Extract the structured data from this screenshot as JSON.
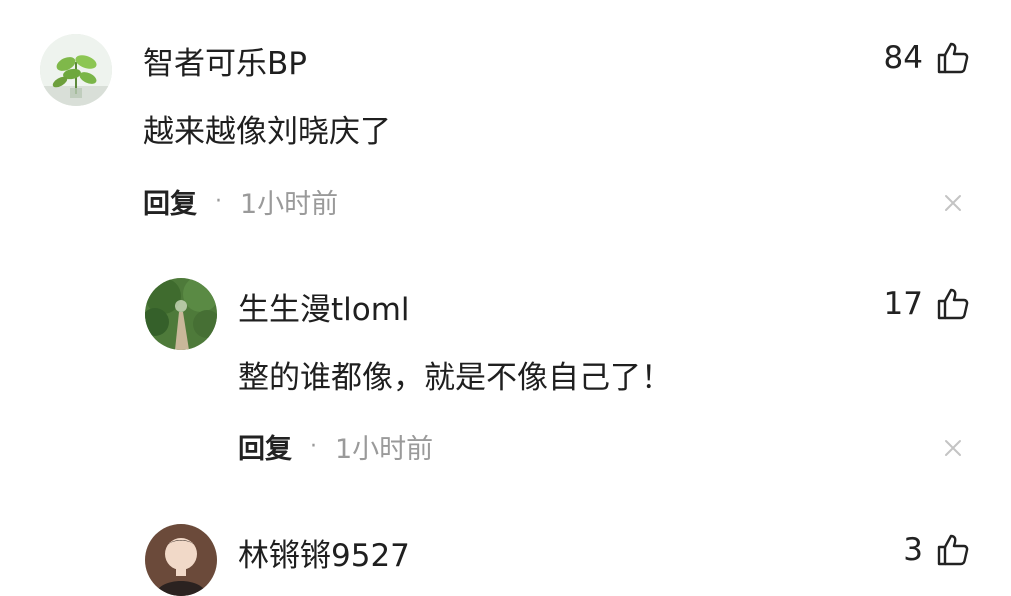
{
  "comments": [
    {
      "username": "智者可乐BP",
      "likes": "84",
      "text": "越来越像刘晓庆了",
      "reply_label": "回复",
      "separator": "·",
      "time": "1小时前"
    },
    {
      "username": "生生漫tloml",
      "likes": "17",
      "text": "整的谁都像，就是不像自己了！",
      "reply_label": "回复",
      "separator": "·",
      "time": "1小时前"
    },
    {
      "username": "林锵锵9527",
      "likes": "3"
    }
  ],
  "icons": {
    "like": "thumbs-up-icon",
    "dismiss": "close-icon"
  },
  "colors": {
    "text": "#1f1f1f",
    "muted": "#9a9a9a",
    "background": "#ffffff"
  }
}
